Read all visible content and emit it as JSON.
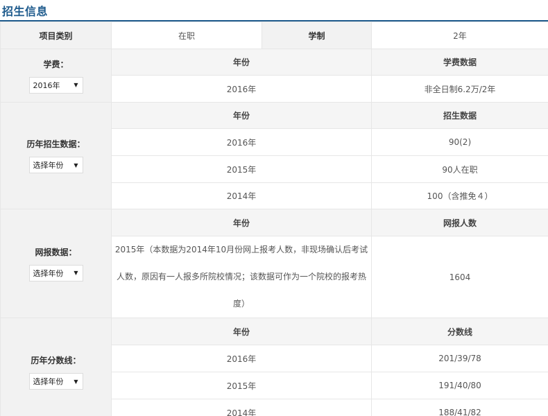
{
  "page_title": "招生信息",
  "top_row": {
    "category_label": "项目类别",
    "category_value": "在职",
    "duration_label": "学制",
    "duration_value": "2年"
  },
  "sections": {
    "tuition": {
      "label": "学费：",
      "select_value": "2016年",
      "headers": [
        "年份",
        "学费数据"
      ],
      "rows": [
        [
          "2016年",
          "非全日制6.2万/2年"
        ]
      ]
    },
    "enrollment": {
      "label": "历年招生数据：",
      "select_value": "选择年份",
      "headers": [
        "年份",
        "招生数据"
      ],
      "rows": [
        [
          "2016年",
          "90(2)"
        ],
        [
          "2015年",
          "90人在职"
        ],
        [
          "2014年",
          "100（含推免４）"
        ]
      ]
    },
    "online": {
      "label": "网报数据：",
      "select_value": "选择年份",
      "headers": [
        "年份",
        "网报人数"
      ],
      "rows": [
        [
          "2015年（本数据为2014年10月份网上报考人数，非现场确认后考试人数，原因有一人报多所院校情况；该数据可作为一个院校的报考热度）",
          "1604"
        ]
      ]
    },
    "scores": {
      "label": "历年分数线：",
      "select_value": "选择年份",
      "headers": [
        "年份",
        "分数线"
      ],
      "rows": [
        [
          "2016年",
          "201/39/78"
        ],
        [
          "2015年",
          "191/40/80"
        ],
        [
          "2014年",
          "188/41/82"
        ]
      ]
    }
  },
  "icons": {
    "dropdown": "chevron-down-icon"
  },
  "colors": {
    "title": "#1d5a8c",
    "label_bg": "#f2f2f2",
    "border": "#e6e6e6"
  }
}
